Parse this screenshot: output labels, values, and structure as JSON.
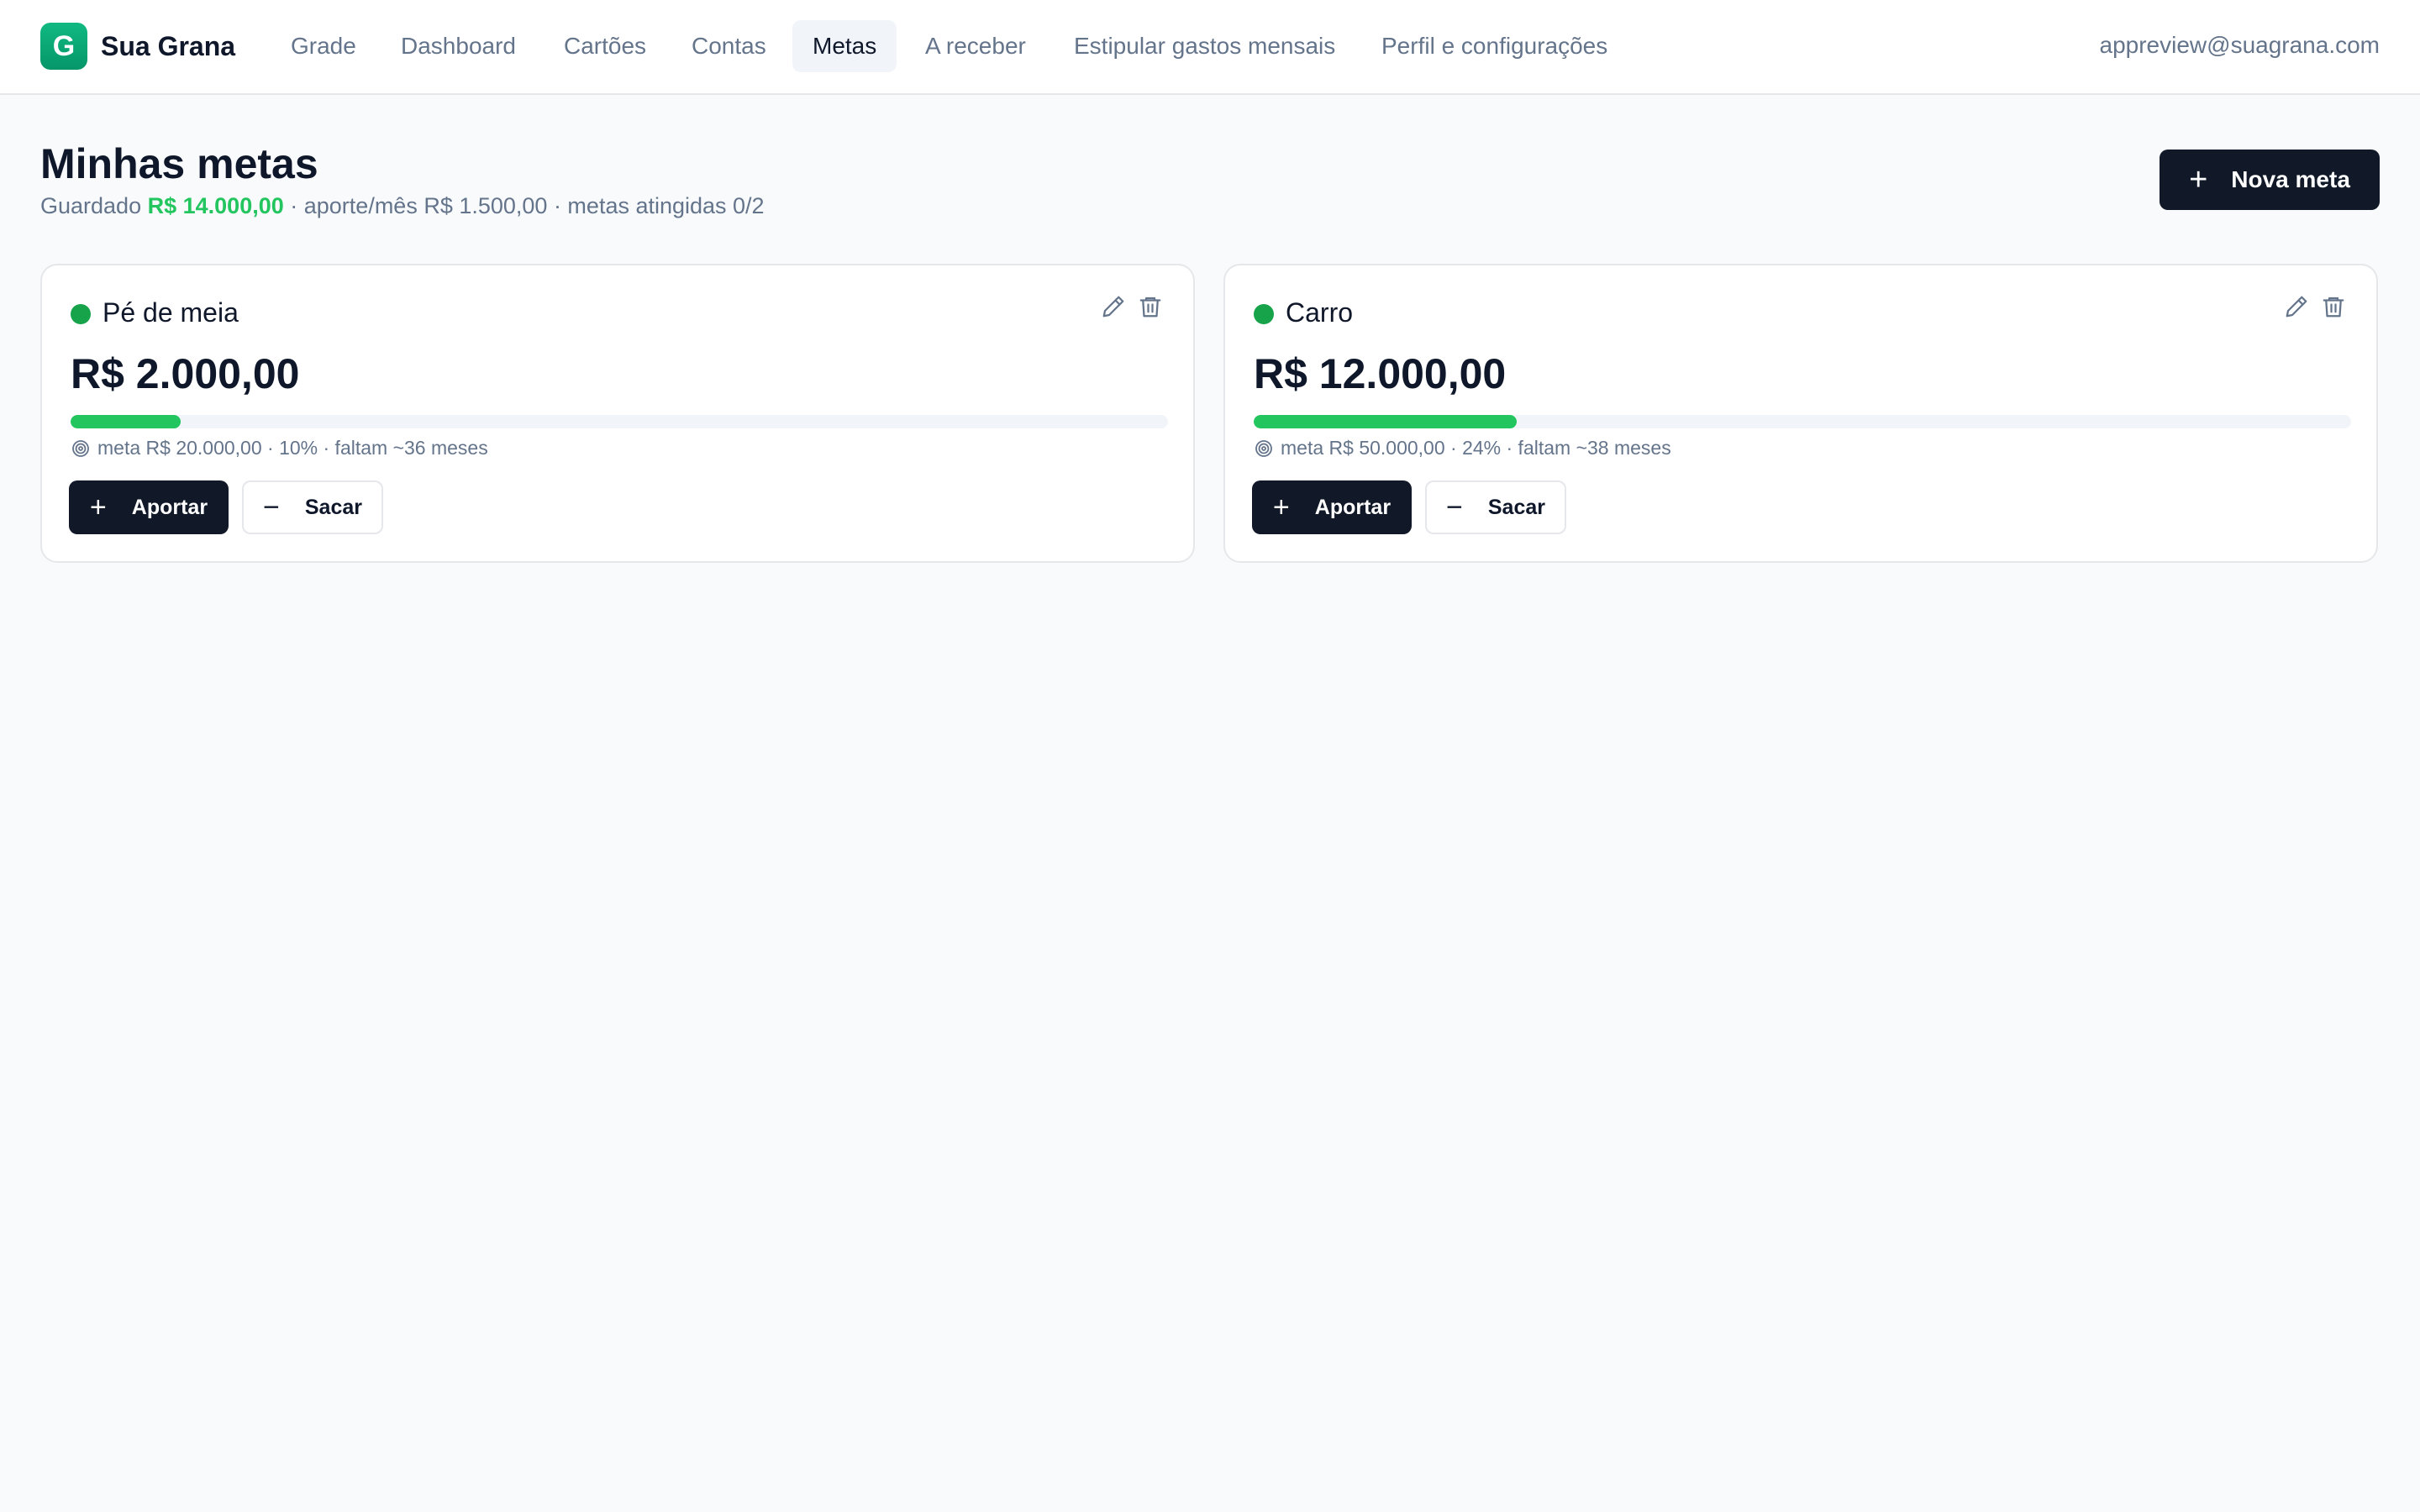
{
  "app": {
    "logo_letter": "G",
    "name": "Sua Grana"
  },
  "nav": {
    "items": [
      {
        "label": "Grade"
      },
      {
        "label": "Dashboard"
      },
      {
        "label": "Cartões"
      },
      {
        "label": "Contas"
      },
      {
        "label": "Metas",
        "active": true
      },
      {
        "label": "A receber"
      },
      {
        "label": "Estipular gastos mensais"
      },
      {
        "label": "Perfil e configurações"
      }
    ]
  },
  "user": {
    "email": "appreview@suagrana.com"
  },
  "page": {
    "title": "Minhas metas",
    "summary": {
      "saved_label": "Guardado",
      "saved_value": "R$ 14.000,00",
      "rest": "· aporte/mês R$ 1.500,00 · metas atingidas 0/2"
    },
    "new_goal_label": "Nova meta"
  },
  "goals": [
    {
      "name": "Pé de meia",
      "amount": "R$ 2.000,00",
      "progress_percent": 10,
      "meta_text": "meta R$ 20.000,00 · 10% · faltam ~36 meses",
      "contribute_label": "Aportar",
      "withdraw_label": "Sacar",
      "color": "#16a34a"
    },
    {
      "name": "Carro",
      "amount": "R$ 12.000,00",
      "progress_percent": 24,
      "meta_text": "meta R$ 50.000,00 · 24% · faltam ~38 meses",
      "contribute_label": "Aportar",
      "withdraw_label": "Sacar",
      "color": "#16a34a"
    }
  ],
  "colors": {
    "accent_green": "#22c55e",
    "primary_dark": "#111827",
    "muted_text": "#64748b",
    "page_bg": "#f8fafc"
  },
  "icons": {
    "edit": "pencil-icon",
    "delete": "trash-icon",
    "target": "target-icon",
    "plus": "plus-icon",
    "minus": "minus-icon"
  }
}
